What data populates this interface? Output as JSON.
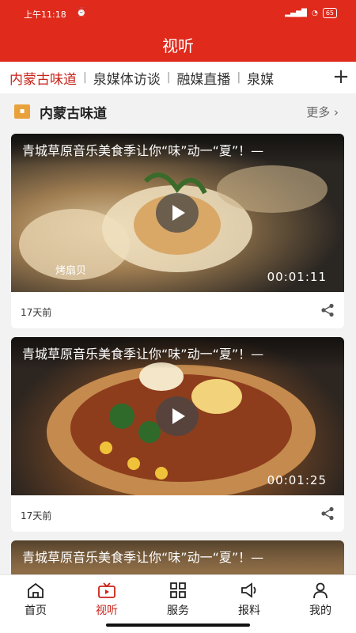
{
  "status_bar": {
    "time": "上午11:18",
    "battery": "65"
  },
  "header": {
    "title": "视听"
  },
  "tabs": [
    {
      "label": "内蒙古味道"
    },
    {
      "label": "泉媒体访谈"
    },
    {
      "label": "融媒直播"
    },
    {
      "label": "泉媒"
    }
  ],
  "tabs_add": "+",
  "section": {
    "title": "内蒙古味道",
    "more": "更多"
  },
  "cards": [
    {
      "title": "青城草原音乐美食季让你“味”动一“夏”！—",
      "duration": "00:01:11",
      "age": "17天前",
      "caption": "烤扇贝"
    },
    {
      "title": "青城草原音乐美食季让你“味”动一“夏”！—",
      "duration": "00:01:25",
      "age": "17天前"
    },
    {
      "title": "青城草原音乐美食季让你“味”动一“夏”！—"
    }
  ],
  "tabbar": [
    {
      "label": "首页",
      "icon": "home-icon"
    },
    {
      "label": "视听",
      "icon": "tv-icon"
    },
    {
      "label": "服务",
      "icon": "grid-icon"
    },
    {
      "label": "报料",
      "icon": "megaphone-icon"
    },
    {
      "label": "我的",
      "icon": "user-icon"
    }
  ],
  "colors": {
    "brand": "#e02a1c",
    "active": "#c9231a"
  }
}
